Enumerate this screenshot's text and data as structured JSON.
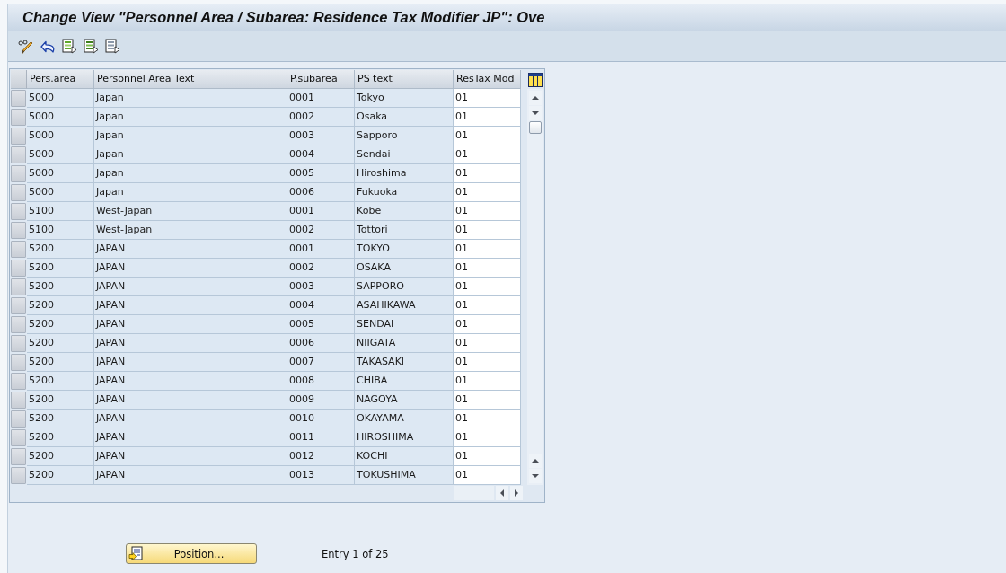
{
  "window": {
    "title": "Change View \"Personnel Area / Subarea: Residence Tax Modifier JP\": Ove"
  },
  "table": {
    "columns": [
      {
        "label": "Pers.area",
        "editable": false
      },
      {
        "label": "Personnel Area Text",
        "editable": false
      },
      {
        "label": "P.subarea",
        "editable": false
      },
      {
        "label": "PS text",
        "editable": false
      },
      {
        "label": "ResTax Mod",
        "editable": true
      }
    ],
    "rows": [
      {
        "cells": [
          "5000",
          "Japan",
          "0001",
          "Tokyo",
          "01"
        ],
        "selected": false
      },
      {
        "cells": [
          "5000",
          "Japan",
          "0002",
          "Osaka",
          "01"
        ],
        "selected": false
      },
      {
        "cells": [
          "5000",
          "Japan",
          "0003",
          "Sapporo",
          "01"
        ],
        "selected": false
      },
      {
        "cells": [
          "5000",
          "Japan",
          "0004",
          "Sendai",
          "01"
        ],
        "selected": false
      },
      {
        "cells": [
          "5000",
          "Japan",
          "0005",
          "Hiroshima",
          "01"
        ],
        "selected": false
      },
      {
        "cells": [
          "5000",
          "Japan",
          "0006",
          "Fukuoka",
          "01"
        ],
        "selected": false
      },
      {
        "cells": [
          "5100",
          "West-Japan",
          "0001",
          "Kobe",
          "01"
        ],
        "selected": false
      },
      {
        "cells": [
          "5100",
          "West-Japan",
          "0002",
          "Tottori",
          "01"
        ],
        "selected": false
      },
      {
        "cells": [
          "5200",
          "JAPAN",
          "0001",
          "TOKYO",
          "01"
        ],
        "selected": false
      },
      {
        "cells": [
          "5200",
          "JAPAN",
          "0002",
          "OSAKA",
          "01"
        ],
        "selected": false
      },
      {
        "cells": [
          "5200",
          "JAPAN",
          "0003",
          "SAPPORO",
          "01"
        ],
        "selected": false
      },
      {
        "cells": [
          "5200",
          "JAPAN",
          "0004",
          "ASAHIKAWA",
          "01"
        ],
        "selected": false
      },
      {
        "cells": [
          "5200",
          "JAPAN",
          "0005",
          "SENDAI",
          "01"
        ],
        "selected": false
      },
      {
        "cells": [
          "5200",
          "JAPAN",
          "0006",
          "NIIGATA",
          "01"
        ],
        "selected": false
      },
      {
        "cells": [
          "5200",
          "JAPAN",
          "0007",
          "TAKASAKI",
          "01"
        ],
        "selected": false
      },
      {
        "cells": [
          "5200",
          "JAPAN",
          "0008",
          "CHIBA",
          "01"
        ],
        "selected": false
      },
      {
        "cells": [
          "5200",
          "JAPAN",
          "0009",
          "NAGOYA",
          "01"
        ],
        "selected": false
      },
      {
        "cells": [
          "5200",
          "JAPAN",
          "0010",
          "OKAYAMA",
          "01"
        ],
        "selected": false
      },
      {
        "cells": [
          "5200",
          "JAPAN",
          "0011",
          "HIROSHIMA",
          "01"
        ],
        "selected": false
      },
      {
        "cells": [
          "5200",
          "JAPAN",
          "0012",
          "KOCHI",
          "01"
        ],
        "selected": false
      },
      {
        "cells": [
          "5200",
          "JAPAN",
          "0013",
          "TOKUSHIMA",
          "01"
        ],
        "selected": false
      }
    ]
  },
  "footer": {
    "position_button": "Position...",
    "entry_info": "Entry 1 of 25"
  }
}
